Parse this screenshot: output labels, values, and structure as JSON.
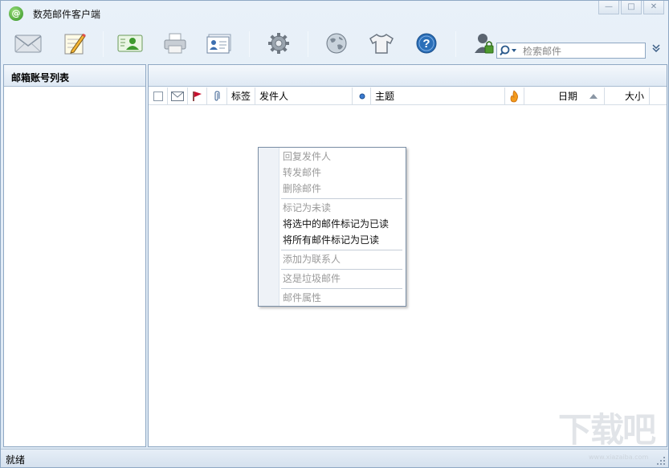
{
  "window": {
    "title": "数苑邮件客户端",
    "controls": [
      "minimize",
      "maximize",
      "close"
    ]
  },
  "toolbar": {
    "buttons": [
      {
        "name": "receive-mail",
        "icon": "envelope-icon"
      },
      {
        "name": "compose",
        "icon": "pencil-note-icon"
      },
      {
        "name": "contacts",
        "icon": "contact-card-icon"
      },
      {
        "name": "print",
        "icon": "printer-icon"
      },
      {
        "name": "address-book",
        "icon": "address-book-icon"
      },
      {
        "name": "settings",
        "icon": "gear-icon"
      },
      {
        "name": "web",
        "icon": "globe-icon"
      },
      {
        "name": "skin",
        "icon": "tshirt-icon"
      },
      {
        "name": "help",
        "icon": "help-icon"
      },
      {
        "name": "account",
        "icon": "user-lock-icon"
      }
    ],
    "search": {
      "placeholder": "检索邮件"
    }
  },
  "left_pane": {
    "header": "邮箱账号列表"
  },
  "mail_list": {
    "columns": [
      "标签",
      "发件人",
      "主题",
      "日期",
      "大小"
    ]
  },
  "context_menu": {
    "items": [
      {
        "label": "回复发件人",
        "enabled": false
      },
      {
        "label": "转发邮件",
        "enabled": false
      },
      {
        "label": "删除邮件",
        "enabled": false
      },
      {
        "label": "标记为未读",
        "enabled": false
      },
      {
        "label": "将选中的邮件标记为已读",
        "enabled": true
      },
      {
        "label": "将所有邮件标记为已读",
        "enabled": true
      },
      {
        "label": "添加为联系人",
        "enabled": false
      },
      {
        "label": "这是垃圾邮件",
        "enabled": false
      },
      {
        "label": "邮件属性",
        "enabled": false
      }
    ]
  },
  "status": {
    "text": "就绪"
  },
  "watermark": {
    "big": "下载吧",
    "small": "www.xiazaiba.com"
  },
  "colors": {
    "accent": "#8fa8c4",
    "flag": "#c8102e",
    "help": "#2b6fb8"
  }
}
